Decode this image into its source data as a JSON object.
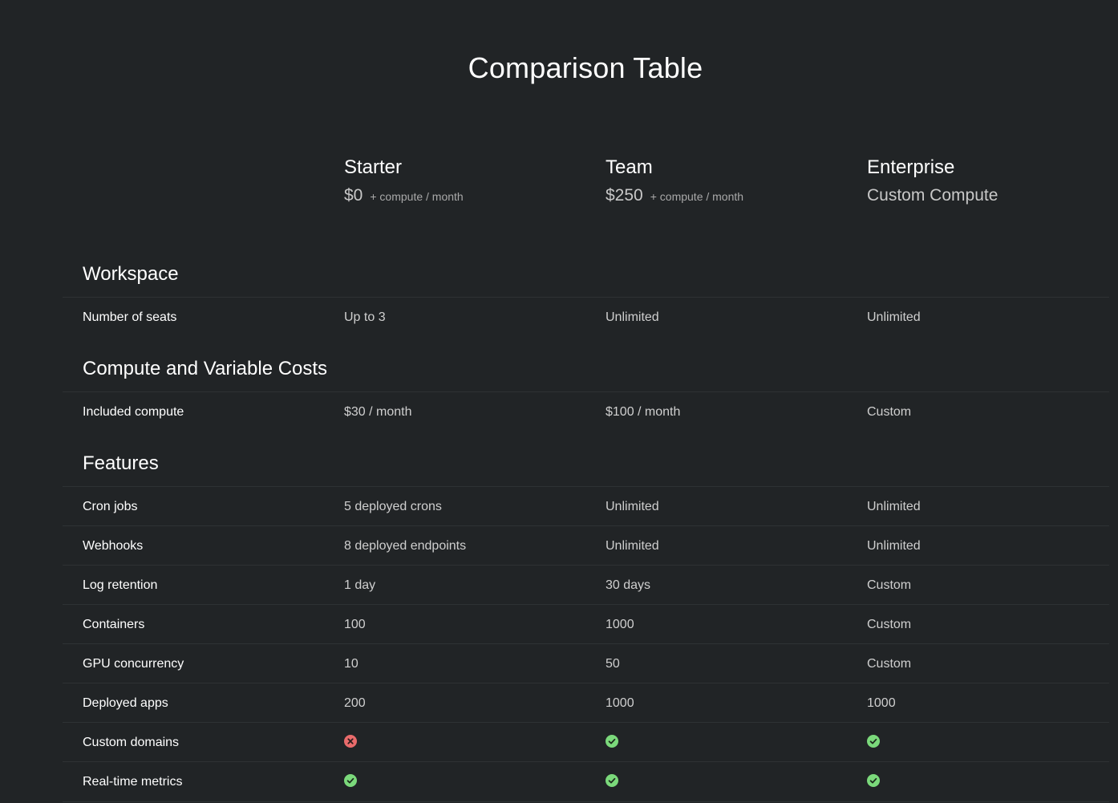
{
  "title": "Comparison Table",
  "plans": [
    {
      "name": "Starter",
      "price": "$0",
      "suffix": "+ compute / month"
    },
    {
      "name": "Team",
      "price": "$250",
      "suffix": "+ compute / month"
    },
    {
      "name": "Enterprise",
      "price_text": "Custom Compute"
    }
  ],
  "sections": {
    "workspace": {
      "title": "Workspace",
      "rows": [
        {
          "label": "Number of seats",
          "values": [
            "Up to 3",
            "Unlimited",
            "Unlimited"
          ]
        }
      ]
    },
    "compute": {
      "title": "Compute and Variable Costs",
      "rows": [
        {
          "label": "Included compute",
          "values": [
            "$30 / month",
            "$100 / month",
            "Custom"
          ]
        }
      ]
    },
    "features": {
      "title": "Features",
      "rows": [
        {
          "label": "Cron jobs",
          "values": [
            "5 deployed crons",
            "Unlimited",
            "Unlimited"
          ]
        },
        {
          "label": "Webhooks",
          "values": [
            "8 deployed endpoints",
            "Unlimited",
            "Unlimited"
          ]
        },
        {
          "label": "Log retention",
          "values": [
            "1 day",
            "30 days",
            "Custom"
          ]
        },
        {
          "label": "Containers",
          "values": [
            "100",
            "1000",
            "Custom"
          ]
        },
        {
          "label": "GPU concurrency",
          "values": [
            "10",
            "50",
            "Custom"
          ]
        },
        {
          "label": "Deployed apps",
          "values": [
            "200",
            "1000",
            "1000"
          ]
        },
        {
          "label": "Custom domains",
          "icons": [
            "x-circle-icon",
            "check-circle-icon",
            "check-circle-icon"
          ]
        },
        {
          "label": "Real-time metrics",
          "icons": [
            "check-circle-icon",
            "check-circle-icon",
            "check-circle-icon"
          ]
        }
      ]
    }
  },
  "colors": {
    "background": "#212426",
    "check": "#7bd97b",
    "cross": "#e96b6b",
    "divider": "#2e3234"
  }
}
